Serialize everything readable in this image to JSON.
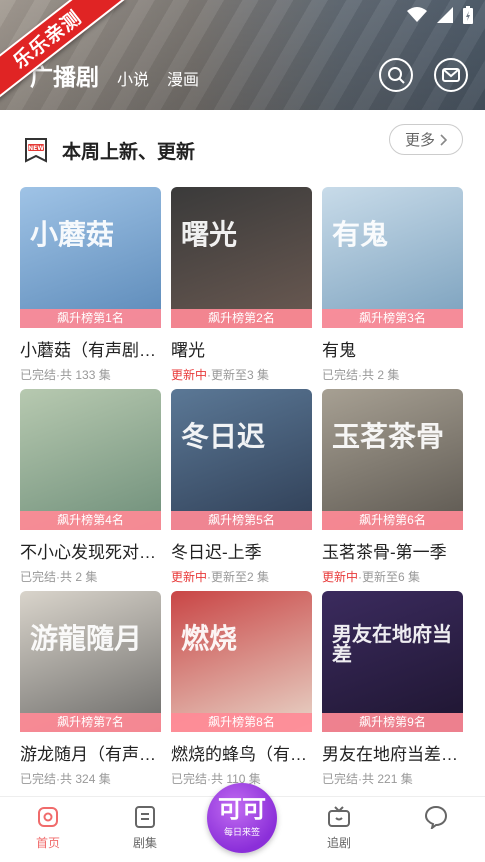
{
  "watermark": "乐乐亲测",
  "header": {
    "tabs": [
      {
        "label": "广播剧",
        "active": true
      },
      {
        "label": "小说",
        "active": false
      },
      {
        "label": "漫画",
        "active": false
      }
    ]
  },
  "section": {
    "title": "本周上新、更新",
    "more_label": "更多",
    "icon": "new-book-icon"
  },
  "items": [
    {
      "title": "小蘑菇（有声剧…",
      "rank": "飙升榜第1名",
      "status": "已完结",
      "count": "·共 133 集",
      "cover_text": "小蘑菇",
      "cover_colors": [
        "#9fc3e6",
        "#5b89b8"
      ]
    },
    {
      "title": "曙光",
      "rank": "飙升榜第2名",
      "status": "更新中",
      "count": "·更新至3 集",
      "cover_text": "曙光",
      "cover_colors": [
        "#3a3a3a",
        "#6b5a52"
      ]
    },
    {
      "title": "有鬼",
      "rank": "飙升榜第3名",
      "status": "已完结",
      "count": "·共 2 集",
      "cover_text": "有鬼",
      "cover_colors": [
        "#c8dbe9",
        "#7aa0bd"
      ]
    },
    {
      "title": "不小心发现死对…",
      "rank": "飙升榜第4名",
      "status": "已完结",
      "count": "·共 2 集",
      "cover_text": "",
      "cover_colors": [
        "#b7c9b0",
        "#6f8f7a"
      ]
    },
    {
      "title": "冬日迟-上季",
      "rank": "飙升榜第5名",
      "status": "更新中",
      "count": "·更新至2 集",
      "cover_text": "冬日迟",
      "cover_colors": [
        "#5b7896",
        "#2f3e55"
      ]
    },
    {
      "title": "玉茗茶骨-第一季",
      "rank": "飙升榜第6名",
      "status": "更新中",
      "count": "·更新至6 集",
      "cover_text": "玉茗茶骨",
      "cover_colors": [
        "#a7a093",
        "#5c5750"
      ]
    },
    {
      "title": "游龙随月（有声…",
      "rank": "飙升榜第7名",
      "status": "已完结",
      "count": "·共 324 集",
      "cover_text": "游龍隨月",
      "cover_colors": [
        "#d9d4cb",
        "#6b6a68"
      ]
    },
    {
      "title": "燃烧的蜂鸟（有…",
      "rank": "飙升榜第8名",
      "status": "已完结",
      "count": "·共 110 集",
      "cover_text": "燃烧",
      "cover_colors": [
        "#c94545",
        "#e8d6c9"
      ]
    },
    {
      "title": "男友在地府当差…",
      "rank": "飙升榜第9名",
      "status": "已完结",
      "count": "·共 221 集",
      "cover_text": "男友在地府当差",
      "cover_colors": [
        "#3b2b5e",
        "#1e1530"
      ]
    }
  ],
  "bottom_nav": [
    {
      "label": "首页",
      "icon": "home-icon",
      "active": true
    },
    {
      "label": "剧集",
      "icon": "list-icon",
      "active": false
    },
    {
      "label": "追剧",
      "icon": "tv-icon",
      "active": false
    },
    {
      "label": "",
      "icon": "bubble-icon",
      "active": false
    }
  ],
  "center_badge": {
    "main": "可可",
    "sub": "每日来签"
  },
  "colors": {
    "accent": "#f06b6b",
    "rank_bg": "#ff8a96",
    "updating": "#e83a3a",
    "badge": "#8b2fd9"
  }
}
